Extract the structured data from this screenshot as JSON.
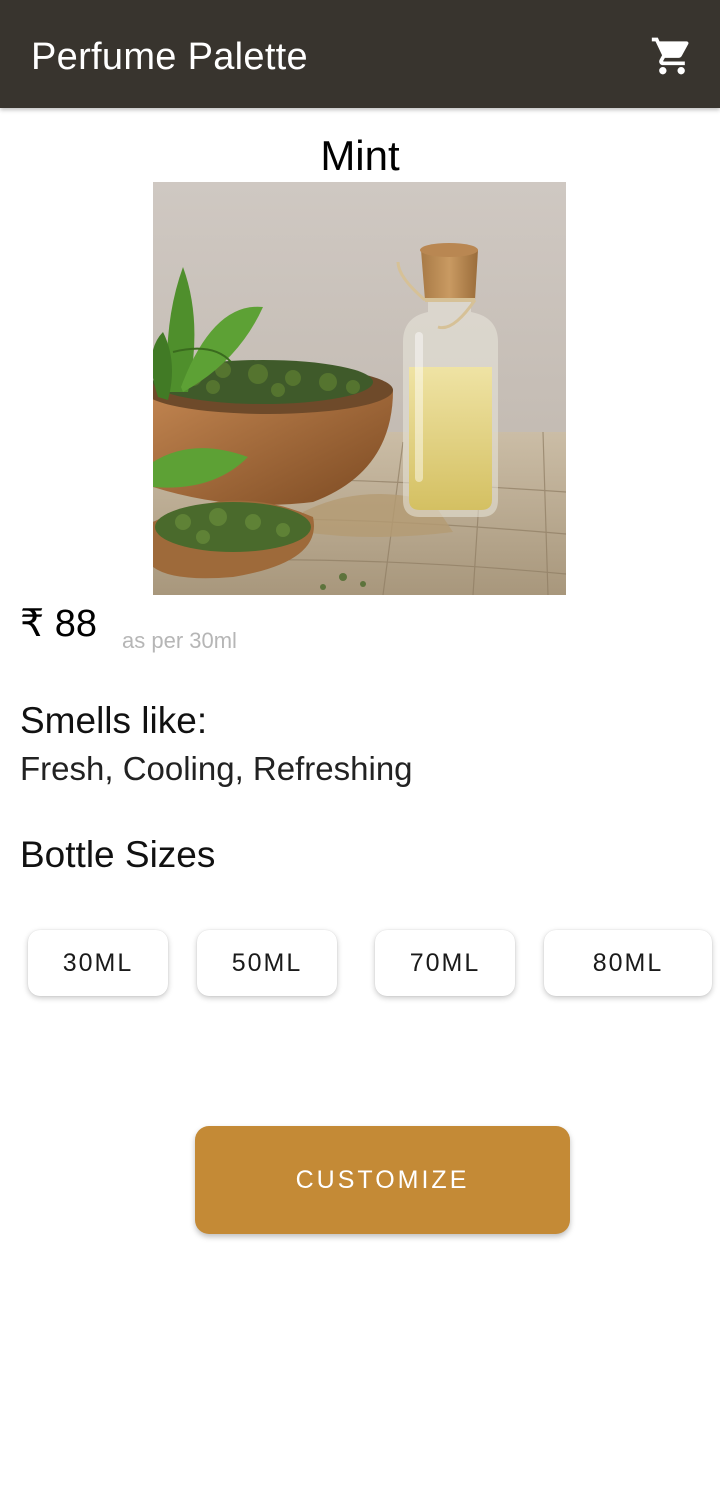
{
  "app_bar": {
    "title": "Perfume Palette",
    "cart_icon": "shopping-cart-icon",
    "background": "#38342e"
  },
  "product": {
    "name": "Mint",
    "image_alt": "Mint leaves in wooden bowl with oil bottle",
    "price": "₹ 88",
    "price_note": "as per 30ml",
    "smells_heading": "Smells like:",
    "smells_text": "Fresh, Cooling, Refreshing"
  },
  "bottle_sizes": {
    "heading": "Bottle Sizes",
    "options": [
      "30ML",
      "50ML",
      "70ML",
      "80ML"
    ]
  },
  "actions": {
    "customize_label": "CUSTOMIZE",
    "accent": "#c48a36"
  }
}
